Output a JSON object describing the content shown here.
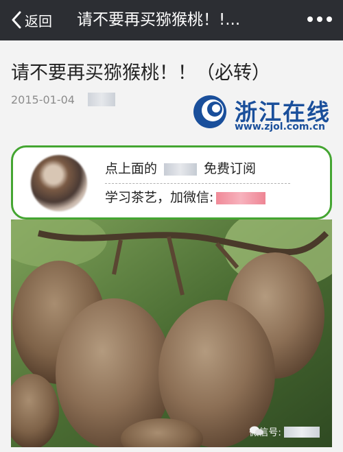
{
  "nav": {
    "back_label": "返回",
    "title": "请不要再买猕猴桃！!..."
  },
  "article": {
    "title": "请不要再买猕猴桃！！（必转）",
    "date": "2015-01-04"
  },
  "logo": {
    "name": "浙江在线",
    "url": "www.zjol.com.cn"
  },
  "subscribe": {
    "line1_prefix": "点上面的",
    "line1_suffix": "免费订阅",
    "line2_prefix": "学习茶艺，加微信:"
  },
  "photo": {
    "watermark": "微信号:"
  },
  "colors": {
    "navbar": "#2c2e33",
    "accent_green": "#44a531",
    "logo_blue": "#1a4f9b"
  },
  "icons": {
    "back": "chevron-left-icon",
    "more": "more-dots-icon",
    "logo": "zjol-logo-icon",
    "wechat": "wechat-icon"
  }
}
